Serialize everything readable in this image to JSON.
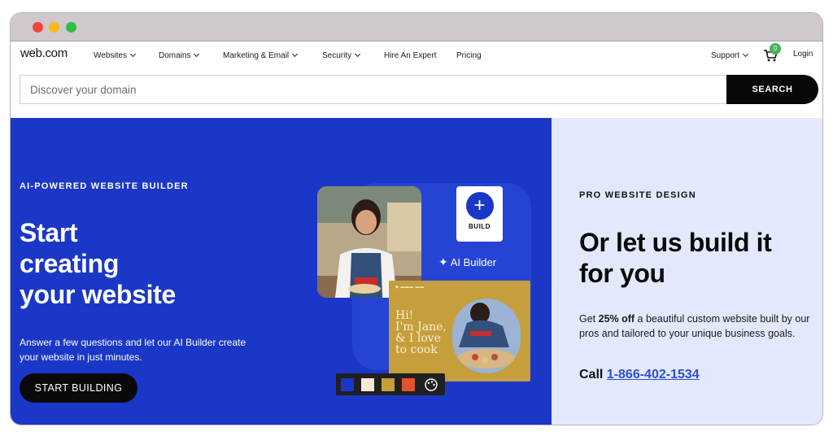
{
  "window": {
    "controls": [
      "close",
      "minimize",
      "maximize"
    ]
  },
  "nav": {
    "logo": "web.com",
    "items": [
      {
        "label": "Websites",
        "dropdown": true
      },
      {
        "label": "Domains",
        "dropdown": true
      },
      {
        "label": "Marketing & Email",
        "dropdown": true
      },
      {
        "label": "Security",
        "dropdown": true
      },
      {
        "label": "Hire An Expert",
        "dropdown": false
      },
      {
        "label": "Pricing",
        "dropdown": false
      }
    ],
    "support": "Support",
    "cart_count": "0",
    "login": "Login"
  },
  "search": {
    "placeholder": "Discover your domain",
    "button": "SEARCH"
  },
  "hero_left": {
    "eyebrow": "AI-POWERED WEBSITE BUILDER",
    "headline_line1": "Start",
    "headline_line2": "creating",
    "headline_line3": "your website",
    "description": "Answer a few questions and let our AI Builder create your website in just minutes.",
    "cta": "START BUILDING",
    "build_card_label": "BUILD",
    "ai_builder_label": "AI Builder",
    "mock_card_line1": "Hi!",
    "mock_card_line2": "I'm Jane,",
    "mock_card_line3": "& I love",
    "mock_card_line4": "to cook",
    "swatch_colors": [
      "#1b37c8",
      "#f3ead5",
      "#c49f3c",
      "#e0542c"
    ]
  },
  "hero_right": {
    "eyebrow": "PRO WEBSITE DESIGN",
    "headline_line1": "Or let us build it",
    "headline_line2": "for you",
    "desc_prefix": "Get ",
    "desc_bold": "25% off",
    "desc_suffix": " a beautiful custom website built by our pros and tailored to your unique business goals.",
    "call_label": "Call ",
    "phone": "1-866-402-1534"
  },
  "colors": {
    "hero_blue": "#1b37c8",
    "hero_right_bg": "#e4e8fc",
    "phone_link": "#2b4fd8",
    "cart_badge": "#42b35d"
  }
}
